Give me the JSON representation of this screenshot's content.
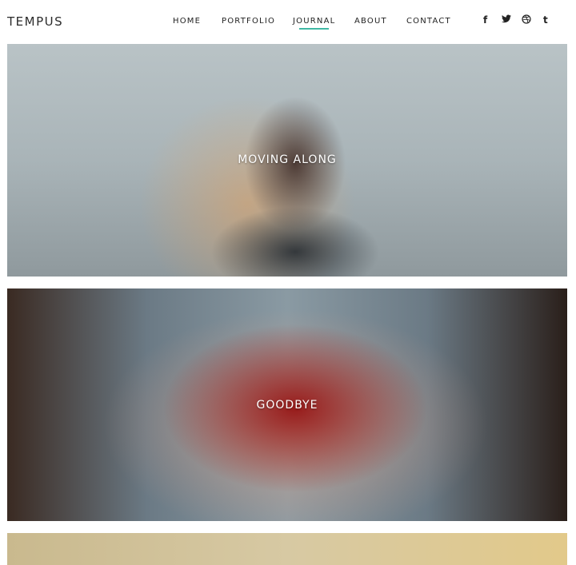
{
  "brand": {
    "logo": "TEMPUS"
  },
  "nav": {
    "items": [
      {
        "label": "HOME"
      },
      {
        "label": "PORTFOLIO"
      },
      {
        "label": "JOURNAL",
        "active": true
      },
      {
        "label": "ABOUT"
      },
      {
        "label": "CONTACT"
      }
    ],
    "accent_color": "#3fb8a4"
  },
  "social": {
    "facebook": "f",
    "twitter": "🐦",
    "dribbble": "◎",
    "tumblr": "t"
  },
  "posts": [
    {
      "title": "MOVING ALONG"
    },
    {
      "title": "GOODBYE"
    }
  ]
}
